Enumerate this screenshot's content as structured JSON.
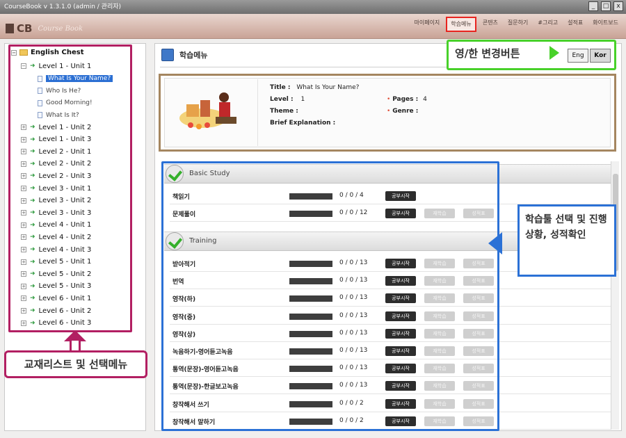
{
  "window": {
    "title": "CourseBook v 1.3.1.0 (admin / 관리자)",
    "min": "_",
    "max": "□",
    "close": "x"
  },
  "header": {
    "logo_text": "CB",
    "logo_sub": "Course Book",
    "nav": [
      "마이페이지",
      "학습메뉴",
      "콘텐츠",
      "질문하기",
      "#그리고",
      "설적표",
      "화이트보드"
    ],
    "active_nav_index": 1
  },
  "tree": {
    "root": "English Chest",
    "expanded": "Level 1 - Unit 1",
    "sub_items": [
      "What Is Your Name?",
      "Who Is He?",
      "Good Morning!",
      "What Is It?"
    ],
    "selected_sub_index": 0,
    "units": [
      "Level 1 - Unit 2",
      "Level 1 - Unit 3",
      "Level 2 - Unit 1",
      "Level 2 - Unit 2",
      "Level 2 - Unit 3",
      "Level 3 - Unit 1",
      "Level 3 - Unit 2",
      "Level 3 - Unit 3",
      "Level 4 - Unit 1",
      "Level 4 - Unit 2",
      "Level 4 - Unit 3",
      "Level 5 - Unit 1",
      "Level 5 - Unit 2",
      "Level 5 - Unit 3",
      "Level 6 - Unit 1",
      "Level 6 - Unit 2",
      "Level 6 - Unit 3"
    ],
    "callout": "교재리스트 및 선택메뉴"
  },
  "content": {
    "title": "학습메뉴",
    "lang_callout": "영/한 변경버튼",
    "lang_buttons": [
      "Eng",
      "Kor"
    ],
    "active_lang_index": 1
  },
  "info": {
    "title_label": "Title :",
    "title_value": "What Is Your Name?",
    "level_label": "Level :",
    "level_value": "1",
    "pages_label": "Pages :",
    "pages_value": "4",
    "theme_label": "Theme :",
    "genre_label": "Genre :",
    "brief_label": "Brief Explanation :"
  },
  "study": {
    "callout": "학습툴 선택 및 진행상황, 성적확인",
    "basic_title": "Basic Study",
    "training_title": "Training",
    "btn_start": "공부시작",
    "btn_review": "재학습",
    "btn_score": "성적표",
    "basic_rows": [
      {
        "name": "책읽기",
        "progress": "0 / 0 / 4",
        "fill": 0
      },
      {
        "name": "문제풀이",
        "progress": "0 / 0 / 12",
        "fill": 0
      }
    ],
    "training_rows": [
      {
        "name": "받아적기",
        "progress": "0 / 0 / 13",
        "fill": 0
      },
      {
        "name": "번역",
        "progress": "0 / 0 / 13",
        "fill": 0
      },
      {
        "name": "영작(하)",
        "progress": "0 / 0 / 13",
        "fill": 0
      },
      {
        "name": "영작(중)",
        "progress": "0 / 0 / 13",
        "fill": 0
      },
      {
        "name": "영작(상)",
        "progress": "0 / 0 / 13",
        "fill": 0
      },
      {
        "name": "녹음하기-영어듣고녹음",
        "progress": "0 / 0 / 13",
        "fill": 0
      },
      {
        "name": "통역(문장)-영어듣고녹음",
        "progress": "0 / 0 / 13",
        "fill": 0
      },
      {
        "name": "통역(문장)-한글보고녹음",
        "progress": "0 / 0 / 13",
        "fill": 0
      },
      {
        "name": "창작해서 쓰기",
        "progress": "0 / 0 / 2",
        "fill": 0
      },
      {
        "name": "창작해서 말하기",
        "progress": "0 / 0 / 2",
        "fill": 0
      }
    ]
  }
}
